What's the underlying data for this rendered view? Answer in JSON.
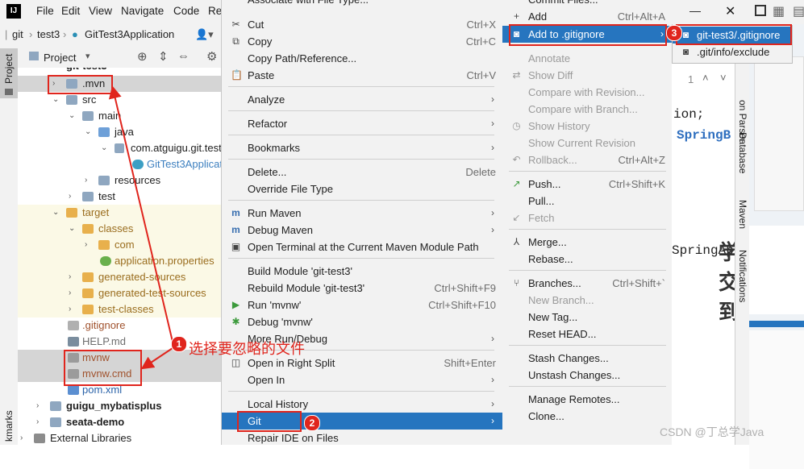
{
  "menubar": {
    "logo": "IJ",
    "items": [
      "File",
      "Edit",
      "View",
      "Navigate",
      "Code",
      "Re"
    ]
  },
  "breadcrumb": {
    "items": [
      "git",
      "test3",
      "GitTest3Application"
    ]
  },
  "side_tabs": {
    "project": "Project",
    "bookmarks": "kmarks"
  },
  "project_panel": {
    "title": "Project",
    "partial_top": "git-test3",
    "tree": [
      ".mvn",
      "src",
      "main",
      "java",
      "com.atguigu.git.test",
      "GitTest3Applicat",
      "resources",
      "test",
      "target",
      "classes",
      "com",
      "application.properties",
      "generated-sources",
      "generated-test-sources",
      "test-classes",
      ".gitignore",
      "HELP.md",
      "mvnw",
      "mvnw.cmd",
      "pom.xml",
      "guigu_mybatisplus",
      "seata-demo",
      "External Libraries"
    ]
  },
  "menu1": {
    "partial_top": "Associate with File Type...",
    "items": [
      {
        "label": "Cut",
        "key": "Ctrl+X"
      },
      {
        "label": "Copy",
        "key": "Ctrl+C"
      },
      {
        "label": "Copy Path/Reference...",
        "key": ""
      },
      {
        "label": "Paste",
        "key": "Ctrl+V"
      },
      {
        "label": "Analyze",
        "key": ""
      },
      {
        "label": "Refactor",
        "key": ""
      },
      {
        "label": "Bookmarks",
        "key": ""
      },
      {
        "label": "Delete...",
        "key": "Delete"
      },
      {
        "label": "Override File Type",
        "key": ""
      },
      {
        "label": "Run Maven",
        "key": ""
      },
      {
        "label": "Debug Maven",
        "key": ""
      },
      {
        "label": "Open Terminal at the Current Maven Module Path",
        "key": ""
      },
      {
        "label": "Build Module 'git-test3'",
        "key": ""
      },
      {
        "label": "Rebuild Module 'git-test3'",
        "key": "Ctrl+Shift+F9"
      },
      {
        "label": "Run 'mvnw'",
        "key": "Ctrl+Shift+F10"
      },
      {
        "label": "Debug 'mvnw'",
        "key": ""
      },
      {
        "label": "More Run/Debug",
        "key": ""
      },
      {
        "label": "Open in Right Split",
        "key": "Shift+Enter"
      },
      {
        "label": "Open In",
        "key": ""
      },
      {
        "label": "Local History",
        "key": ""
      },
      {
        "label": "Git",
        "key": ""
      },
      {
        "label": "Repair IDE on Files",
        "key": ""
      }
    ]
  },
  "menu2": {
    "partial_top": "Commit Files...",
    "items": [
      {
        "label": "Add",
        "key": "Ctrl+Alt+A"
      },
      {
        "label": "Add to .gitignore",
        "key": ""
      },
      {
        "label": "Annotate",
        "key": ""
      },
      {
        "label": "Show Diff",
        "key": ""
      },
      {
        "label": "Compare with Revision...",
        "key": ""
      },
      {
        "label": "Compare with Branch...",
        "key": ""
      },
      {
        "label": "Show History",
        "key": ""
      },
      {
        "label": "Show Current Revision",
        "key": ""
      },
      {
        "label": "Rollback...",
        "key": "Ctrl+Alt+Z"
      },
      {
        "label": "Push...",
        "key": "Ctrl+Shift+K"
      },
      {
        "label": "Pull...",
        "key": ""
      },
      {
        "label": "Fetch",
        "key": ""
      },
      {
        "label": "Merge...",
        "key": ""
      },
      {
        "label": "Rebase...",
        "key": ""
      },
      {
        "label": "Branches...",
        "key": "Ctrl+Shift+`"
      },
      {
        "label": "New Branch...",
        "key": ""
      },
      {
        "label": "New Tag...",
        "key": ""
      },
      {
        "label": "Reset HEAD...",
        "key": ""
      },
      {
        "label": "Stash Changes...",
        "key": ""
      },
      {
        "label": "Unstash Changes...",
        "key": ""
      },
      {
        "label": "Manage Remotes...",
        "key": ""
      },
      {
        "label": "Clone...",
        "key": ""
      }
    ]
  },
  "menu3": {
    "items": [
      "git-test3/.gitignore",
      ".git/info/exclude"
    ]
  },
  "editor": {
    "line_count": "1",
    "code_lines": [
      "ion;",
      "SpringB",
      "SpringAp"
    ],
    "big_text": "学交到"
  },
  "right_tabs": [
    "on Parser",
    "Database",
    "Maven",
    "Notifications"
  ],
  "annotations": {
    "badge1": "1",
    "badge2": "2",
    "badge3": "3",
    "label1": "选择要忽略的文件"
  },
  "watermark": "CSDN @丁总学Java",
  "colors": {
    "highlight": "#2675bf",
    "annotation": "#e0251d"
  }
}
